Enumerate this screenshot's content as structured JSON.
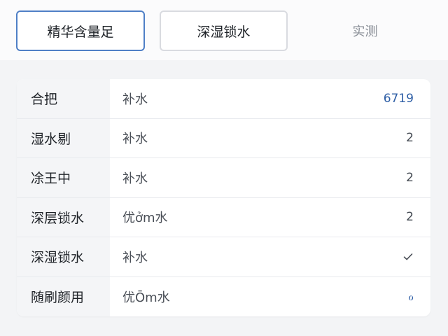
{
  "tabs": [
    {
      "label": "精华含量足"
    },
    {
      "label": "深湿锁水"
    },
    {
      "label": "实测"
    }
  ],
  "rows": [
    {
      "key": "合把",
      "value": "补水",
      "end": "6719",
      "end_color": "#2f5fa6"
    },
    {
      "key": "湿水剔",
      "value": "补水",
      "end": "2"
    },
    {
      "key": "凃王中",
      "value": "补水",
      "end": "2"
    },
    {
      "key": "深层锁水",
      "value": "优ởm水",
      "end": "2"
    },
    {
      "key": "深湿锁水",
      "value": "补水",
      "end_icon": "check-icon"
    },
    {
      "key": "随刷颜用",
      "value": "优Ōm水",
      "end": "ℴ",
      "end_color": "#2f5fa6"
    }
  ]
}
